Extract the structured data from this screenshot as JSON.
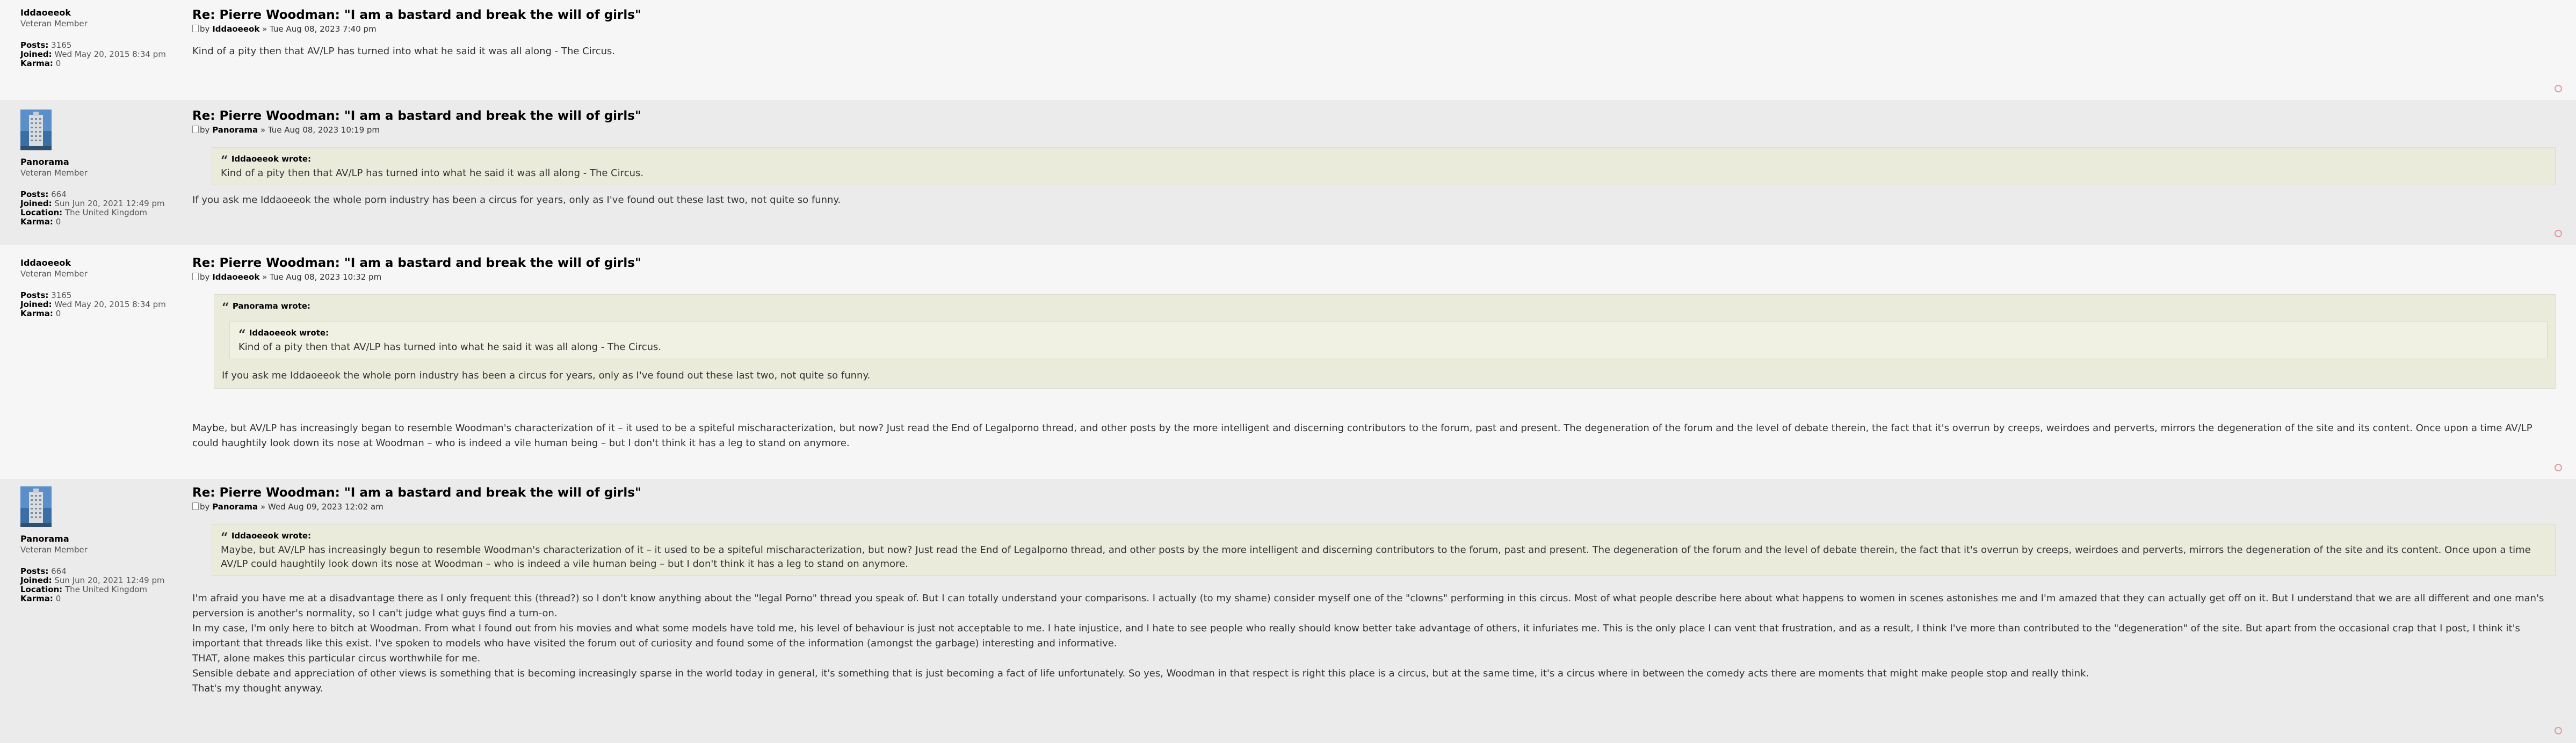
{
  "accent": "#cc3333",
  "posts": [
    {
      "author": {
        "name": "Iddaoeeok",
        "rank": "Veteran Member",
        "posts": "3165",
        "joined": "Wed May 20, 2015 8:34 pm",
        "karma": "0"
      },
      "title": "Re: Pierre Woodman: \"I am a bastard and break the will of girls\"",
      "by": "by",
      "byname": "Iddaoeeok",
      "date": "» Tue Aug 08, 2023 7:40 pm",
      "body": [
        "Kind of a pity then that AV/LP has turned into what he said it was all along - The Circus."
      ]
    },
    {
      "author": {
        "name": "Panorama",
        "rank": "Veteran Member",
        "posts": "664",
        "joined": "Sun Jun 20, 2021 12:49 pm",
        "location": "The United Kingdom",
        "karma": "0"
      },
      "title": "Re: Pierre Woodman: \"I am a bastard and break the will of girls\"",
      "by": "by",
      "byname": "Panorama",
      "date": "» Tue Aug 08, 2023 10:19 pm",
      "quote": {
        "cite": "Iddaoeeok wrote:",
        "text": "Kind of a pity then that AV/LP has turned into what he said it was all along - The Circus."
      },
      "body": [
        "If you ask me Iddaoeeok the whole porn industry has been a circus for years, only as I've found out these last two, not quite so funny."
      ]
    },
    {
      "author": {
        "name": "Iddaoeeok",
        "rank": "Veteran Member",
        "posts": "3165",
        "joined": "Wed May 20, 2015 8:34 pm",
        "karma": "0"
      },
      "title": "Re: Pierre Woodman: \"I am a bastard and break the will of girls\"",
      "by": "by",
      "byname": "Iddaoeeok",
      "date": "» Tue Aug 08, 2023 10:32 pm",
      "quote": {
        "cite": "Panorama wrote:",
        "inner": {
          "cite": "Iddaoeeok wrote:",
          "text": "Kind of a pity then that AV/LP has turned into what he said it was all along - The Circus."
        },
        "text": "If you ask me Iddaoeeok the whole porn industry has been a circus for years, only as I've found out these last two, not quite so funny."
      },
      "body": [
        "Maybe, but AV/LP has increasingly began to resemble Woodman's characterization of it – it used to be a spiteful mischaracterization, but now? Just read the End of Legalporno thread, and other posts by the more intelligent and discerning contributors to the forum, past and present. The degeneration of the forum and the level of debate therein, the fact that it's overrun by creeps, weirdoes and perverts, mirrors the degeneration of the site and its content. Once upon a time AV/LP could haughtily look down its nose at Woodman – who is indeed a vile human being – but I don't think it has a leg to stand on anymore."
      ]
    },
    {
      "author": {
        "name": "Panorama",
        "rank": "Veteran Member",
        "posts": "664",
        "joined": "Sun Jun 20, 2021 12:49 pm",
        "location": "The United Kingdom",
        "karma": "0"
      },
      "title": "Re: Pierre Woodman: \"I am a bastard and break the will of girls\"",
      "by": "by",
      "byname": "Panorama",
      "date": "» Wed Aug 09, 2023 12:02 am",
      "quote": {
        "cite": "Iddaoeeok wrote:",
        "text": "Maybe, but AV/LP has increasingly begun to resemble Woodman's characterization of it – it used to be a spiteful mischaracterization, but now? Just read the End of Legalporno thread, and other posts by the more intelligent and discerning contributors to the forum, past and present. The degeneration of the forum and the level of debate therein, the fact that it's overrun by creeps, weirdoes and perverts, mirrors the degeneration of the site and its content. Once upon a time AV/LP could haughtily look down its nose at Woodman – who is indeed a vile human being – but I don't think it has a leg to stand on anymore."
      },
      "body": [
        "I'm afraid you have me at a disadvantage there as I only frequent this (thread?) so I don't know anything about the \"legal Porno\" thread you speak of. But I can totally understand your comparisons. I actually (to my shame) consider myself one of the \"clowns\" performing in this circus. Most of what people describe here about what happens to women in scenes astonishes me and I'm amazed that they can actually get off on it. But I understand that we are all different and one man's perversion is another's normality, so I can't judge what guys find a turn-on.",
        "In my case, I'm only here to bitch at Woodman. From what I found out from his movies and what some models have told me, his level of behaviour is just not acceptable to me. I hate injustice, and I hate to see people who really should know better take advantage of others, it infuriates me. This is the only place I can vent that frustration, and as a result, I think I've more than contributed to the \"degeneration\" of the site. But apart from the occasional crap that I post, I think it's important that threads like this exist. I've spoken to models who have visited the forum out of curiosity and found some of the information (amongst the garbage) interesting and informative.",
        "THAT, alone makes this particular circus worthwhile for me.",
        "Sensible debate and appreciation of other views is something that is becoming increasingly sparse in the world today in general, it's something that is just becoming a fact of life unfortunately. So yes, Woodman in that respect is right this place is a circus, but at the same time, it's a circus where in between the comedy acts there are moments that might make people stop and really think.",
        "That's my thought anyway."
      ]
    }
  ],
  "labels": {
    "posts": "Posts:",
    "joined": "Joined:",
    "location": "Location:",
    "karma": "Karma:"
  },
  "icons": {
    "avatar": "building-avatar",
    "quote": "quote-icon",
    "post": "post-icon",
    "top": "back-to-top-icon"
  }
}
